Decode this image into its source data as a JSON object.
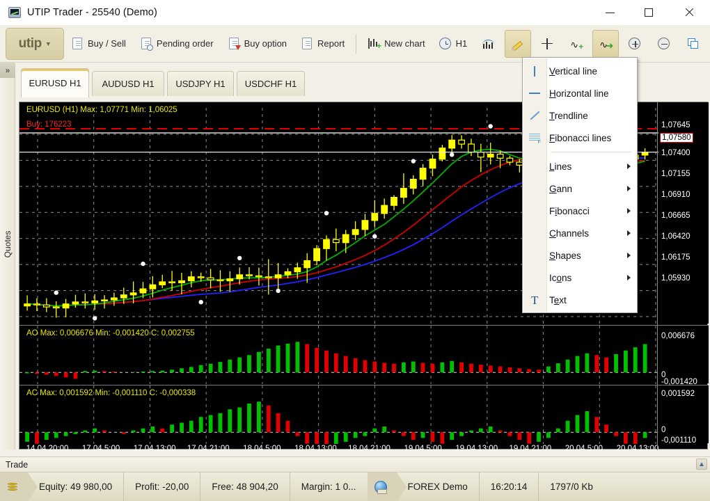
{
  "window": {
    "title": "UTIP Trader - 25540 (Demo)",
    "icon": "app-chart-icon",
    "controls": {
      "minimize": "minimize-icon",
      "maximize": "maximize-icon",
      "close": "close-icon"
    }
  },
  "toolbar": {
    "brand": {
      "label": "utip",
      "caret": "▼"
    },
    "items": [
      {
        "label": "Buy / Sell",
        "icon": "document-icon"
      },
      {
        "label": "Pending order",
        "icon": "document-clock-icon"
      },
      {
        "label": "Buy option",
        "icon": "document-arrow-icon"
      },
      {
        "label": "Report",
        "icon": "report-icon"
      },
      {
        "label": "New chart",
        "icon": "new-chart-icon"
      },
      {
        "label": "H1",
        "icon": "clock-icon"
      }
    ],
    "icon_buttons": [
      {
        "name": "indicators-icon",
        "active": false
      },
      {
        "name": "pencil-draw-icon",
        "active": true
      },
      {
        "name": "crosshair-icon",
        "active": false
      },
      {
        "name": "add-object-icon",
        "active": false
      },
      {
        "name": "object-arrow-icon",
        "active": true
      },
      {
        "name": "zoom-in-icon",
        "active": false
      },
      {
        "name": "zoom-out-icon",
        "active": false
      },
      {
        "name": "tile-windows-icon",
        "active": false
      }
    ]
  },
  "left_rail": {
    "expand": "»",
    "label": "Quotes"
  },
  "tabs": [
    {
      "label": "EURUSD H1",
      "active": true
    },
    {
      "label": "AUDUSD H1",
      "active": false
    },
    {
      "label": "USDJPY H1",
      "active": false
    },
    {
      "label": "USDCHF H1",
      "active": false
    }
  ],
  "menu": {
    "title": "draw-objects-menu",
    "items": [
      {
        "label": "Vertical line",
        "accel": "V",
        "icon": "vertical-line-icon",
        "submenu": false
      },
      {
        "label": "Horizontal line",
        "accel": "H",
        "icon": "horizontal-line-icon",
        "submenu": false
      },
      {
        "label": "Trendline",
        "accel": "T",
        "icon": "trendline-icon",
        "submenu": false
      },
      {
        "label": "Fibonacci lines",
        "accel": "F",
        "icon": "fibonacci-lines-icon",
        "submenu": false
      },
      {
        "separator": true
      },
      {
        "label": "Lines",
        "accel": "L",
        "icon": null,
        "submenu": true
      },
      {
        "label": "Gann",
        "accel": "G",
        "icon": null,
        "submenu": true
      },
      {
        "label": "Fibonacci",
        "accel": "i",
        "icon": null,
        "submenu": true
      },
      {
        "label": "Channels",
        "accel": "C",
        "icon": null,
        "submenu": true
      },
      {
        "label": "Shapes",
        "accel": "S",
        "icon": null,
        "submenu": true
      },
      {
        "label": "Icons",
        "accel": "o",
        "icon": null,
        "submenu": true
      },
      {
        "label": "Text",
        "accel": "e",
        "icon": "text-tool-icon",
        "submenu": false
      }
    ]
  },
  "chart_data": {
    "type": "line",
    "title": "EURUSD (H1)  Max: 1,07771  Min: 1,06025",
    "symbol": "EURUSD",
    "timeframe": "H1",
    "max": "1,07771",
    "min": "1,06025",
    "buy_label": "Buy: 176223",
    "live_price": "1,07580",
    "price_ticks": [
      "1,07645",
      "1,07400",
      "1,07155",
      "1,06910",
      "1,06665",
      "1,06420",
      "1,06175",
      "1,05930"
    ],
    "time_ticks": [
      "14.04 20:00",
      "17.04 5:00",
      "17.04 13:00",
      "17.04 21:00",
      "18.04 5:00",
      "18.04 13:00",
      "18.04 21:00",
      "19.04 5:00",
      "19.04 13:00",
      "19.04 21:00",
      "20.04 5:00",
      "20.04 13:00"
    ],
    "ylim": [
      1.0593,
      1.07771
    ],
    "grid": true,
    "legend": "none",
    "series": [
      {
        "name": "candles",
        "color": "#ffff00"
      },
      {
        "name": "MA fast",
        "color": "#00c000"
      },
      {
        "name": "MA mid",
        "color": "#d00000"
      },
      {
        "name": "MA slow",
        "color": "#2020ff"
      },
      {
        "name": "fractals",
        "color": "#ffffff"
      }
    ],
    "closes": [
      1.0607,
      1.0606,
      1.0604,
      1.0603,
      1.0607,
      1.0609,
      1.0608,
      1.061,
      1.0611,
      1.0613,
      1.0616,
      1.0618,
      1.0622,
      1.0626,
      1.0629,
      1.0628,
      1.063,
      1.0634,
      1.0633,
      1.0631,
      1.063,
      1.0632,
      1.0636,
      1.0635,
      1.0634,
      1.0633,
      1.0636,
      1.0639,
      1.0643,
      1.065,
      1.0662,
      1.0671,
      1.0668,
      1.0676,
      1.0681,
      1.069,
      1.0697,
      1.0705,
      1.0713,
      1.0722,
      1.0731,
      1.0742,
      1.0751,
      1.0762,
      1.077,
      1.0766,
      1.0758,
      1.0753,
      1.0756,
      1.0752,
      1.0748,
      1.0745,
      1.0747,
      1.0752,
      1.0756,
      1.0754,
      1.0751,
      1.0748,
      1.0744,
      1.074,
      1.0743,
      1.0747,
      1.0751,
      1.0755,
      1.0758
    ]
  },
  "indicator_panels": [
    {
      "name": "AO",
      "label": "AO  Max: 0,006676  Min: -0,001420  C: 0,002755",
      "max": "0,006676",
      "min": "-0,001420",
      "current": "0,002755",
      "ticks": [
        "0,006676",
        "0",
        "-0,001420"
      ],
      "type": "bar",
      "values": [
        -0.0002,
        -0.0003,
        -0.0005,
        -0.0008,
        -0.0011,
        -0.0014,
        0.0003,
        0.0004,
        0.0003,
        0.0002,
        0.0,
        0.0001,
        0.0002,
        0.0003,
        0.0004,
        0.0006,
        0.0009,
        0.0012,
        0.0016,
        0.0019,
        0.0023,
        0.0028,
        0.0033,
        0.0038,
        0.0045,
        0.0052,
        0.0059,
        0.0063,
        0.0067,
        0.0062,
        0.0054,
        0.0048,
        0.0042,
        0.0036,
        0.0031,
        0.0027,
        0.0024,
        0.0021,
        0.0019,
        0.0022,
        0.0024,
        0.0021,
        0.0019,
        0.0022,
        0.0025,
        0.0022,
        0.0019,
        0.0017,
        0.0015,
        0.0013,
        0.0011,
        0.0009,
        0.0007,
        0.0006,
        0.0013,
        0.002,
        0.0028,
        0.0036,
        0.0042,
        0.0038,
        0.0033,
        0.004,
        0.0048,
        0.0055,
        0.0062
      ]
    },
    {
      "name": "AC",
      "label": "AC  Max: 0,001592  Min: -0,001110  C: -0,000338",
      "max": "0,001592",
      "min": "-0,001110",
      "current": "-0,000338",
      "ticks": [
        "0,001592",
        "0",
        "-0,001110"
      ],
      "type": "bar",
      "values": [
        -0.0005,
        -0.0006,
        -0.0004,
        -0.0003,
        -0.0002,
        -0.0001,
        0.0001,
        0.0002,
        0.0001,
        0.0,
        -0.0001,
        0.0001,
        0.0002,
        0.0003,
        0.0002,
        0.0004,
        0.0005,
        0.0006,
        0.0008,
        0.0009,
        0.001,
        0.0012,
        0.0013,
        0.0015,
        0.0016,
        0.0014,
        0.001,
        0.0006,
        -0.0002,
        -0.0006,
        -0.0009,
        -0.0011,
        -0.0008,
        -0.0005,
        -0.0003,
        -0.0002,
        0.0002,
        0.0003,
        0.0001,
        -0.0002,
        -0.0004,
        -0.0003,
        -0.0005,
        -0.0006,
        -0.0004,
        -0.0002,
        0.0001,
        0.0002,
        0.0003,
        0.0001,
        -0.0002,
        -0.0004,
        -0.0006,
        -0.0005,
        -0.0003,
        0.0002,
        0.0006,
        0.0009,
        0.0011,
        0.0008,
        0.0004,
        -0.0002,
        -0.0006,
        -0.0009,
        -0.0003
      ]
    }
  ],
  "trade_bar": {
    "label": "Trade",
    "collapse_icon": "chevron-up-icon"
  },
  "status_bar": {
    "account_icon": "coins-icon",
    "cells": [
      "Equity: 49 980,00",
      "Profit: -20,00",
      "Free: 48 904,20",
      "Margin: 1 0..."
    ],
    "server_icon": "globe-icon",
    "server": "FOREX Demo",
    "time": "16:20:14",
    "traffic": "1797/0 Kb"
  },
  "colors": {
    "accent": "#e7c96b",
    "chart_bg": "#000000",
    "candle": "#ffff00",
    "up": "#00a000",
    "down": "#d00000",
    "grid": "#8a8a8a"
  }
}
